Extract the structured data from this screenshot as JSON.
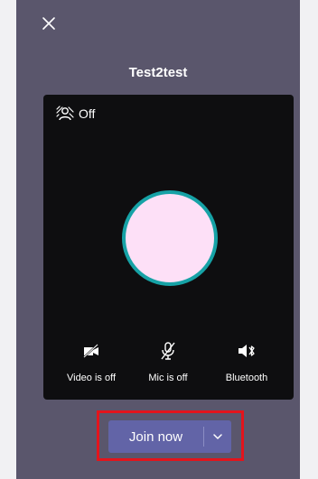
{
  "meeting": {
    "title": "Test2test"
  },
  "preview": {
    "background_effect_label": "Off",
    "controls": [
      {
        "label": "Video is off",
        "icon": "video-off-icon"
      },
      {
        "label": "Mic is off",
        "icon": "mic-off-icon"
      },
      {
        "label": "Bluetooth",
        "icon": "bluetooth-speaker-icon"
      }
    ]
  },
  "join": {
    "label": "Join now"
  },
  "colors": {
    "app_background": "#5a566c",
    "preview_background": "#0e0e10",
    "avatar_fill": "#fde0f7",
    "avatar_ring": "#16a2a6",
    "join_button": "#6264a7",
    "highlight_box": "#e3141c"
  }
}
